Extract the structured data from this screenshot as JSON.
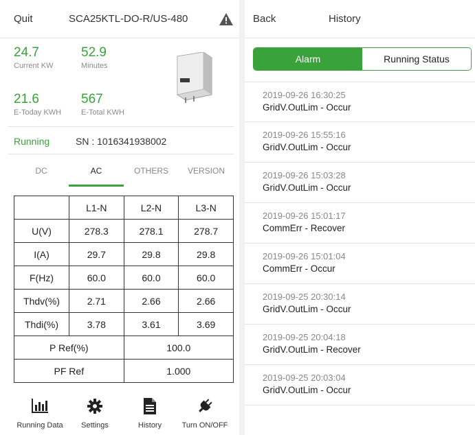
{
  "left": {
    "header": {
      "quit_label": "Quit",
      "model": "SCA25KTL-DO-R/US-480",
      "warning_icon": "warning-triangle-icon"
    },
    "stats": {
      "current_kw": {
        "value": "24.7",
        "label": "Current KW"
      },
      "minutes": {
        "value": "52.9",
        "label": "Minutes"
      },
      "e_today": {
        "value": "21.6",
        "label": "E-Today KWH"
      },
      "e_total": {
        "value": "567",
        "label": "E-Total KWH"
      }
    },
    "status": {
      "state": "Running",
      "sn": "SN : 1016341938002"
    },
    "tabs": [
      {
        "label": "DC",
        "active": false
      },
      {
        "label": "AC",
        "active": true
      },
      {
        "label": "OTHERS",
        "active": false
      },
      {
        "label": "VERSION",
        "active": false
      }
    ],
    "table": {
      "headers": [
        "",
        "L1-N",
        "L2-N",
        "L3-N"
      ],
      "rows": [
        [
          "U(V)",
          "278.3",
          "278.1",
          "278.7"
        ],
        [
          "I(A)",
          "29.7",
          "29.8",
          "29.8"
        ],
        [
          "F(Hz)",
          "60.0",
          "60.0",
          "60.0"
        ],
        [
          "Thdv(%)",
          "2.71",
          "2.66",
          "2.66"
        ],
        [
          "Thdi(%)",
          "3.78",
          "3.61",
          "3.69"
        ]
      ],
      "pref": {
        "label": "P Ref(%)",
        "value": "100.0"
      },
      "pfref": {
        "label": "PF Ref",
        "value": "1.000"
      }
    },
    "nav": [
      {
        "label": "Running Data",
        "icon": "bar-chart-icon"
      },
      {
        "label": "Settings",
        "icon": "gear-icon"
      },
      {
        "label": "History",
        "icon": "document-icon"
      },
      {
        "label": "Turn ON/OFF",
        "icon": "plug-icon"
      }
    ],
    "accent": "#3aa23a"
  },
  "right": {
    "header": {
      "back_label": "Back",
      "title": "History"
    },
    "segments": {
      "alarm": "Alarm",
      "running_status": "Running Status"
    },
    "history": [
      {
        "time": "2019-09-26 16:30:25",
        "event": "GridV.OutLim - Occur"
      },
      {
        "time": "2019-09-26 15:55:16",
        "event": "GridV.OutLim - Occur"
      },
      {
        "time": "2019-09-26 15:03:28",
        "event": "GridV.OutLim - Occur"
      },
      {
        "time": "2019-09-26 15:01:17",
        "event": "CommErr - Recover"
      },
      {
        "time": "2019-09-26 15:01:04",
        "event": "CommErr - Occur"
      },
      {
        "time": "2019-09-25 20:30:14",
        "event": "GridV.OutLim - Occur"
      },
      {
        "time": "2019-09-25 20:04:18",
        "event": "GridV.OutLim - Recover"
      },
      {
        "time": "2019-09-25 20:03:04",
        "event": "GridV.OutLim - Occur"
      }
    ]
  }
}
